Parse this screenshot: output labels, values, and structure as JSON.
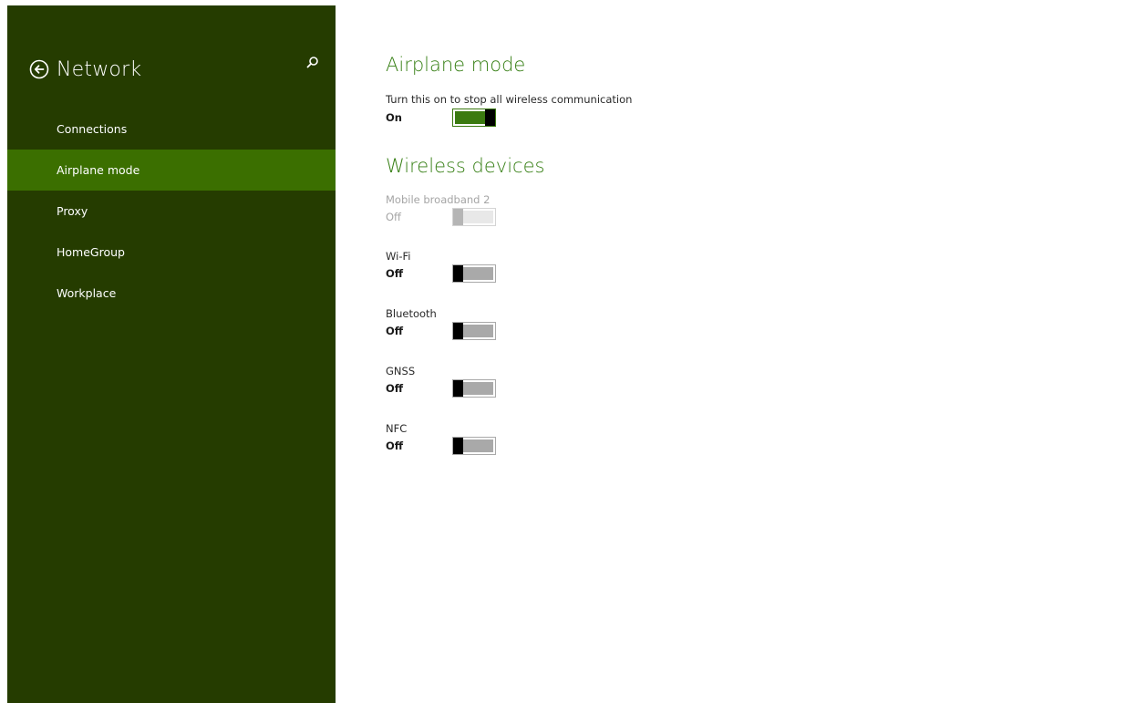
{
  "header": {
    "title": "Network",
    "back_icon": "back-arrow-icon",
    "search_icon": "search-icon"
  },
  "nav": {
    "items": [
      {
        "label": "Connections",
        "selected": false
      },
      {
        "label": "Airplane mode",
        "selected": true
      },
      {
        "label": "Proxy",
        "selected": false
      },
      {
        "label": "HomeGroup",
        "selected": false
      },
      {
        "label": "Workplace",
        "selected": false
      }
    ]
  },
  "airplane": {
    "title": "Airplane mode",
    "description": "Turn this on to stop all wireless communication",
    "state": "On"
  },
  "wireless": {
    "title": "Wireless devices",
    "devices": [
      {
        "label": "Mobile broadband 2",
        "state": "Off",
        "disabled": true
      },
      {
        "label": "Wi-Fi",
        "state": "Off",
        "disabled": false
      },
      {
        "label": "Bluetooth",
        "state": "Off",
        "disabled": false
      },
      {
        "label": "GNSS",
        "state": "Off",
        "disabled": false
      },
      {
        "label": "NFC",
        "state": "Off",
        "disabled": false
      }
    ]
  },
  "colors": {
    "sidebar_bg": "#253c00",
    "selected_bg": "#3b6f00",
    "accent": "#367f14",
    "toggle_on": "#3b7a10"
  }
}
